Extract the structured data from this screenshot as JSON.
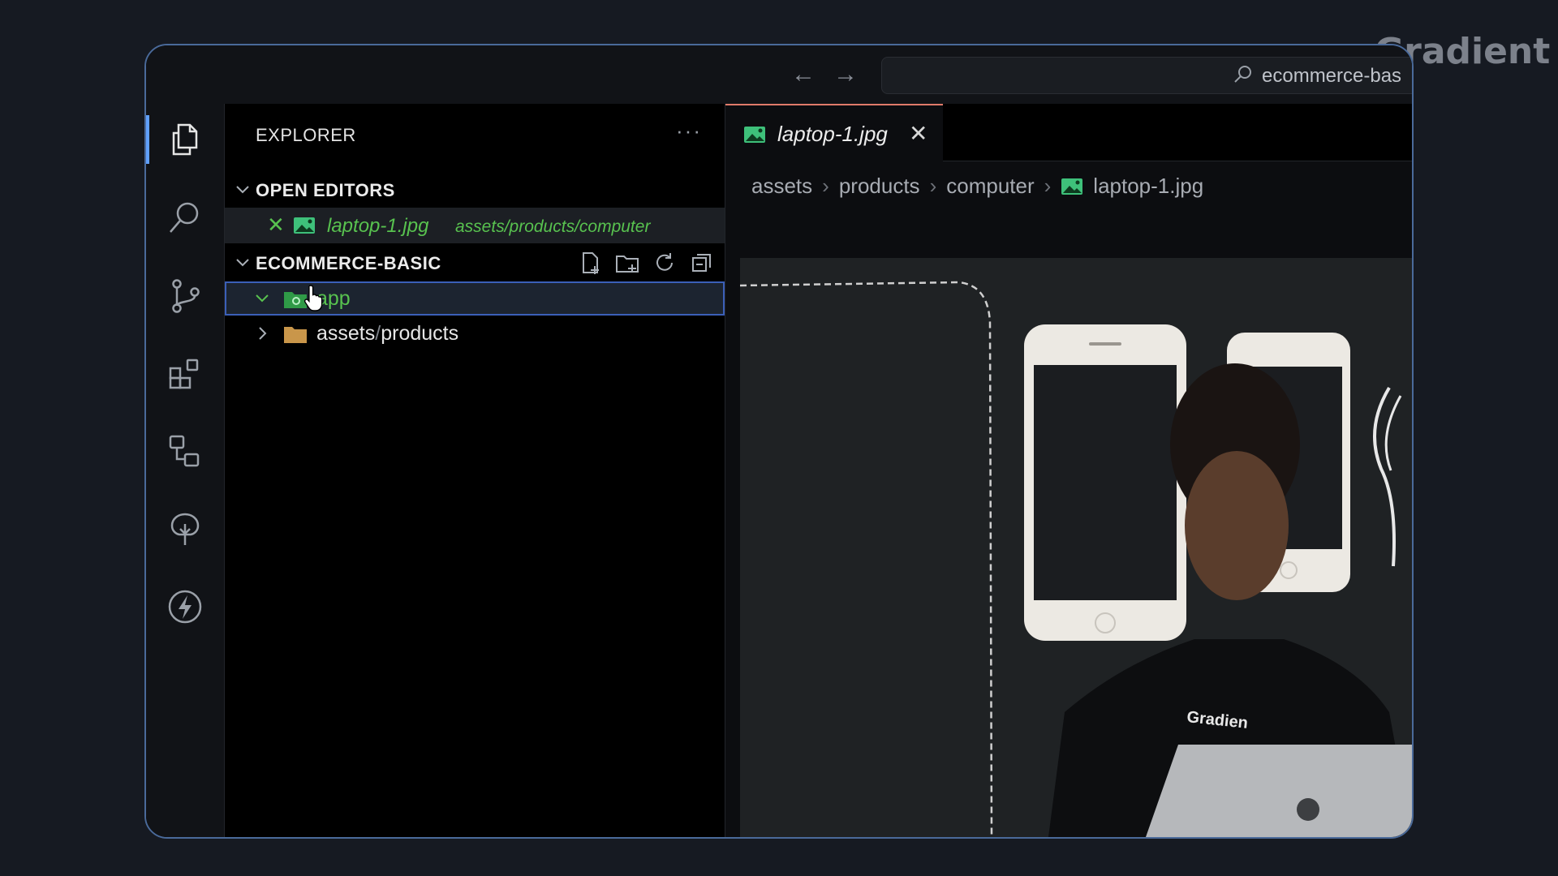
{
  "watermark": "Gradient",
  "titlebar": {
    "back_icon": "arrow-left-icon",
    "forward_icon": "arrow-right-icon",
    "search_text": "ecommerce-bas"
  },
  "activity_bar": [
    {
      "icon": "files-icon",
      "active": true
    },
    {
      "icon": "search-icon"
    },
    {
      "icon": "source-control-icon"
    },
    {
      "icon": "extensions-icon"
    },
    {
      "icon": "remote-explorer-icon"
    },
    {
      "icon": "tree-icon"
    },
    {
      "icon": "lightning-icon"
    }
  ],
  "sidebar": {
    "title": "EXPLORER",
    "more": "···",
    "open_editors": {
      "label": "OPEN EDITORS",
      "file": {
        "name": "laptop-1.jpg",
        "path": "assets/products/computer"
      }
    },
    "project": {
      "label": "ECOMMERCE-BASIC",
      "actions": [
        "new-file-icon",
        "new-folder-icon",
        "refresh-icon",
        "collapse-all-icon"
      ],
      "items": [
        {
          "label": "app",
          "expanded": true,
          "selected": true,
          "color": "#58c24f"
        },
        {
          "label": "assets",
          "sep": "/",
          "label2": "products",
          "expanded": false
        }
      ]
    }
  },
  "editor": {
    "tab": {
      "label": "laptop-1.jpg",
      "close": "✕"
    },
    "breadcrumb": [
      "assets",
      "products",
      "computer",
      "laptop-1.jpg"
    ]
  },
  "colors": {
    "accent": "#5fa0ff",
    "git_added": "#58c24f",
    "tab_border": "#e07a6a"
  }
}
